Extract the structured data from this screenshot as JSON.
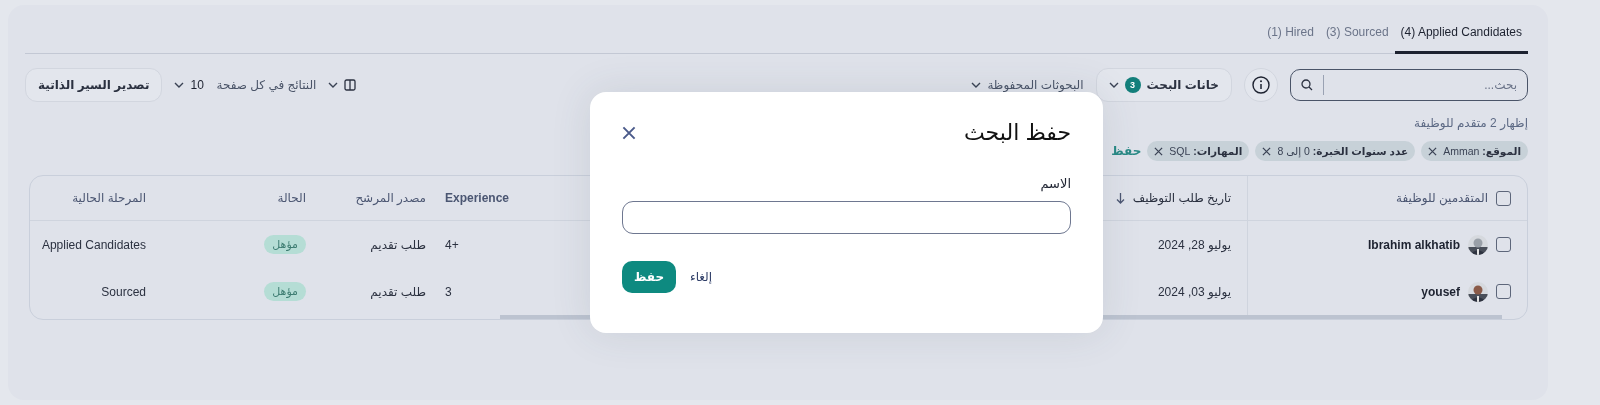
{
  "tabs": [
    {
      "label": "(4) Applied Candidates",
      "selected": true
    },
    {
      "label": "(3) Sourced",
      "selected": false
    },
    {
      "label": "(1) Hired",
      "selected": false
    }
  ],
  "toolbar": {
    "search": {
      "placeholder": "بحث..."
    },
    "search_fields": {
      "label": "خانات البحث",
      "count": "3"
    },
    "saved_searches": "البحوثات المحفوظة",
    "per_page": {
      "label": "النتائج في كل صفحة",
      "value": "10"
    },
    "export_button": "تصدير السير الذاتية"
  },
  "results_summary": "إظهار 2 متقدم للوظيفة",
  "filters": [
    {
      "text": "**الموقع:** Amman"
    },
    {
      "text": "**عدد سنوات الخبرة:** 0 إلى 8"
    },
    {
      "text": "**المهارات:** SQL"
    }
  ],
  "save_link": "حفظ",
  "table": {
    "select_all": {
      "checked": false
    },
    "columns": [
      {
        "kind": "name",
        "label": "المتقدمين للوظيفة",
        "sorted": false
      },
      {
        "kind": "date",
        "label": "تاريخ طلب التوظيف",
        "sorted": true
      },
      {
        "kind": "experience",
        "label": "Experience",
        "sorted": false
      },
      {
        "kind": "source",
        "label": "مصدر المرشح",
        "sorted": false
      },
      {
        "kind": "status",
        "label": "الحالة",
        "sorted": false
      },
      {
        "kind": "stage",
        "label": "المرحلة الحالية",
        "sorted": false
      }
    ],
    "rows": [
      {
        "checked": false,
        "name": "Ibrahim alkhatib",
        "date": "يوليو 28, 2024",
        "experience": "4+",
        "source": "طلب تقديم",
        "status": "مؤهل",
        "stage": "Applied Candidates"
      },
      {
        "checked": false,
        "name": "yousef",
        "date": "يوليو 03, 2024",
        "experience": "3",
        "source": "طلب تقديم",
        "status": "مؤهل",
        "stage": "Sourced"
      }
    ]
  },
  "modal": {
    "title": "حفظ البحث",
    "field_label": "الاسم",
    "save_button": "حفظ",
    "cancel_button": "إلغاء"
  }
}
